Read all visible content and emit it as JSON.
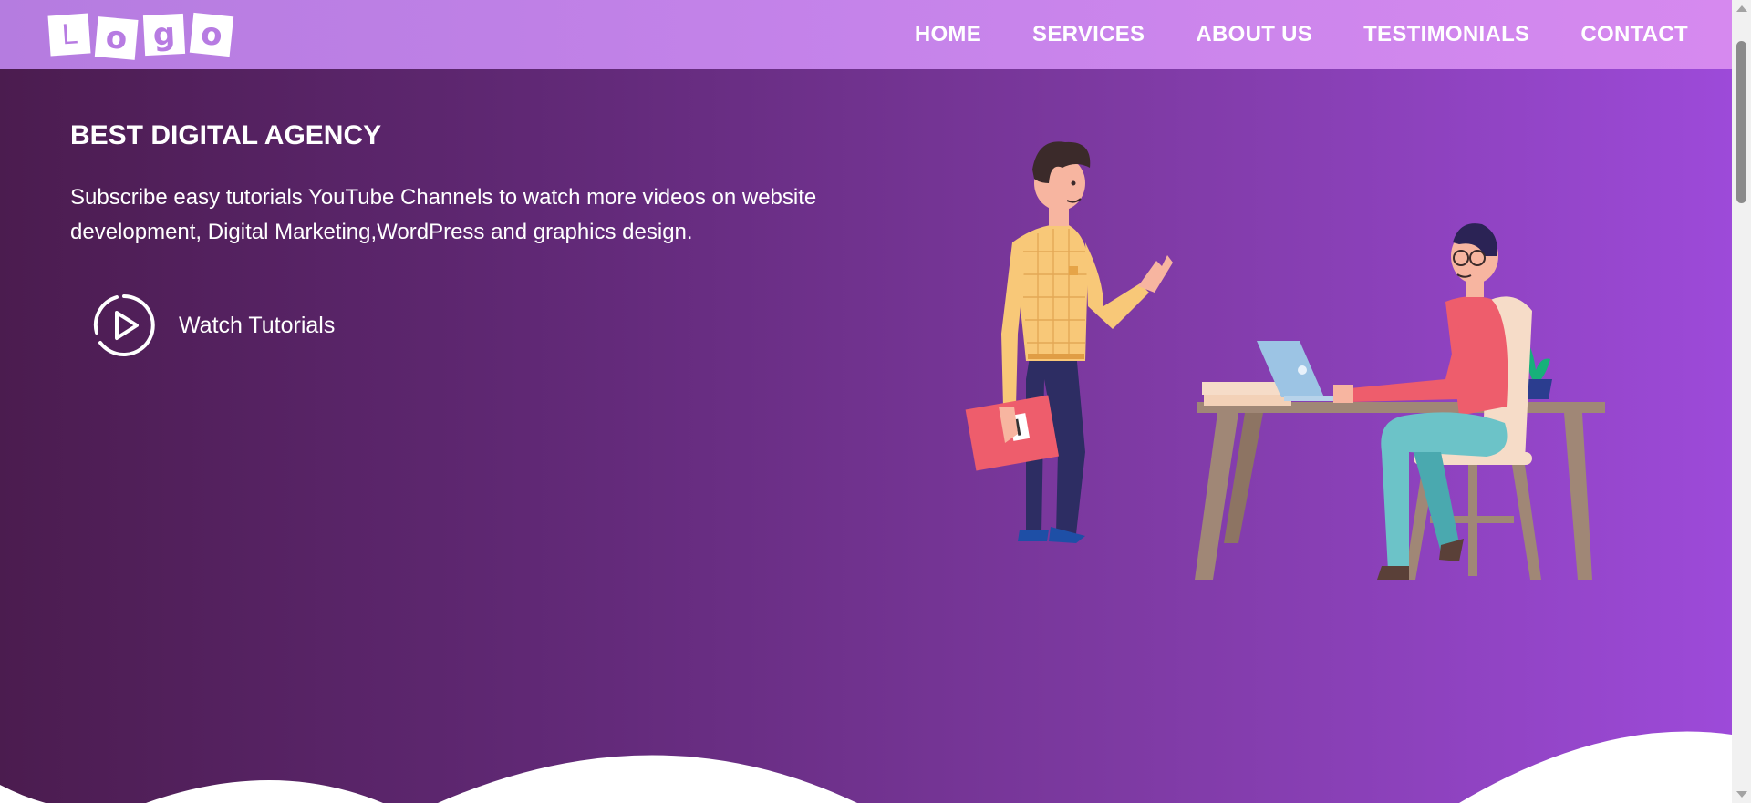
{
  "logo": {
    "letters": [
      "L",
      "o",
      "g",
      "o"
    ]
  },
  "nav": {
    "items": [
      {
        "label": "HOME"
      },
      {
        "label": "SERVICES"
      },
      {
        "label": "ABOUT US"
      },
      {
        "label": "TESTIMONIALS"
      },
      {
        "label": "CONTACT"
      }
    ]
  },
  "hero": {
    "title": "BEST DIGITAL AGENCY",
    "description": "Subscribe easy tutorials YouTube Channels to watch more videos on website development, Digital Marketing,WordPress and graphics design.",
    "cta_label": "Watch Tutorials",
    "cta_icon": "play-circle-icon",
    "illustration": "office-workers-illustration"
  },
  "colors": {
    "nav_start": "#b57ce0",
    "nav_end": "#d689ef",
    "hero_start": "#4b1c4f",
    "hero_end": "#9d4ad9",
    "text": "#ffffff"
  }
}
